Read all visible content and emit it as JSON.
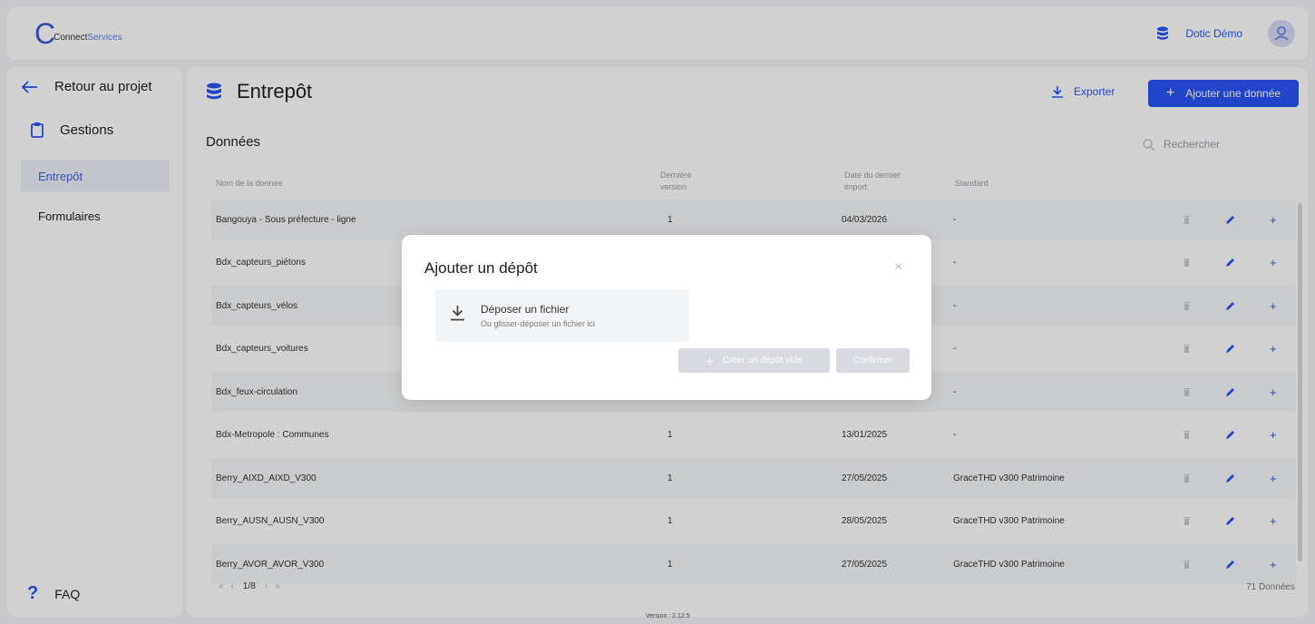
{
  "header": {
    "logo": {
      "letter": "C",
      "part1": "Connect",
      "part2": "Services"
    },
    "user_name": "Dotic Démo"
  },
  "sidebar": {
    "back_label": "Retour au projet",
    "gestions_label": "Gestions",
    "items": [
      {
        "label": "Entrepôt",
        "active": true
      },
      {
        "label": "Formulaires",
        "active": false
      }
    ],
    "faq_label": "FAQ"
  },
  "main": {
    "title": "Entrepôt",
    "export_label": "Exporter",
    "add_label": "Ajouter une donnée",
    "section_title": "Données",
    "search_placeholder": "Rechercher",
    "columns": {
      "name": "Nom de la donnée",
      "version_l1": "Dernière",
      "version_l2": "version",
      "date_l1": "Date du dernier",
      "date_l2": "import",
      "standard": "Standard"
    },
    "rows": [
      {
        "name": "Bangouya - Sous préfecture - ligne",
        "version": "1",
        "date": "04/03/2026",
        "standard": "-"
      },
      {
        "name": "Bdx_capteurs_piétons",
        "version": "",
        "date": "",
        "standard": "-"
      },
      {
        "name": "Bdx_capteurs_vélos",
        "version": "",
        "date": "",
        "standard": "-"
      },
      {
        "name": "Bdx_capteurs_voitures",
        "version": "",
        "date": "",
        "standard": "-"
      },
      {
        "name": "Bdx_feux-circulation",
        "version": "",
        "date": "",
        "standard": "-"
      },
      {
        "name": "Bdx-Metropole : Communes",
        "version": "1",
        "date": "13/01/2025",
        "standard": "-"
      },
      {
        "name": "Berry_AIXD_AIXD_V300",
        "version": "1",
        "date": "27/05/2025",
        "standard": "GraceTHD v300 Patrimoine"
      },
      {
        "name": "Berry_AUSN_AUSN_V300",
        "version": "1",
        "date": "28/05/2025",
        "standard": "GraceTHD v300 Patrimoine"
      },
      {
        "name": "Berry_AVOR_AVOR_V300",
        "version": "1",
        "date": "27/05/2025",
        "standard": "GraceTHD v300 Patrimoine"
      }
    ],
    "pagination": {
      "first": "«",
      "prev": "‹",
      "page": "1/8",
      "next": "›",
      "last": "»"
    },
    "total_label": "71 Données"
  },
  "version_label": "Version : 2.12.5",
  "modal": {
    "title": "Ajouter un dépôt",
    "close": "×",
    "dropzone_title": "Déposer un fichier",
    "dropzone_subtitle": "Ou glisser-déposer un fichier ici",
    "create_empty_label": "Créer un dépôt vide",
    "confirm_label": "Confirmer"
  },
  "colors": {
    "accent": "#2955f5",
    "active_bg": "#eef1fb",
    "disabled": "#d8dadf"
  }
}
